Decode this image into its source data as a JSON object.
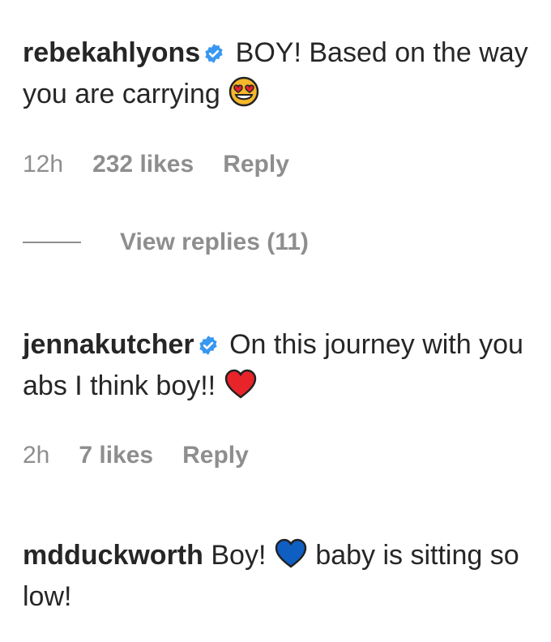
{
  "comments": [
    {
      "username": "rebekahlyons",
      "verified": true,
      "text_before": "BOY! Based on the way you are carrying",
      "emoji": "heart-eyes-emoji",
      "time": "12h",
      "likes": "232 likes",
      "reply": "Reply"
    },
    {
      "username": "jennakutcher",
      "verified": true,
      "text_before": "On this journey with you abs I think boy!!",
      "emoji": "red-heart-emoji",
      "time": "2h",
      "likes": "7 likes",
      "reply": "Reply"
    },
    {
      "username": "mdduckworth",
      "verified": false,
      "text_before": "Boy!",
      "emoji": "blue-heart-emoji",
      "text_after": "baby is sitting so low!"
    }
  ],
  "view_replies": "View replies (11)",
  "colors": {
    "text": "#262626",
    "meta": "#8e8e8e",
    "verified": "#3897f0"
  }
}
